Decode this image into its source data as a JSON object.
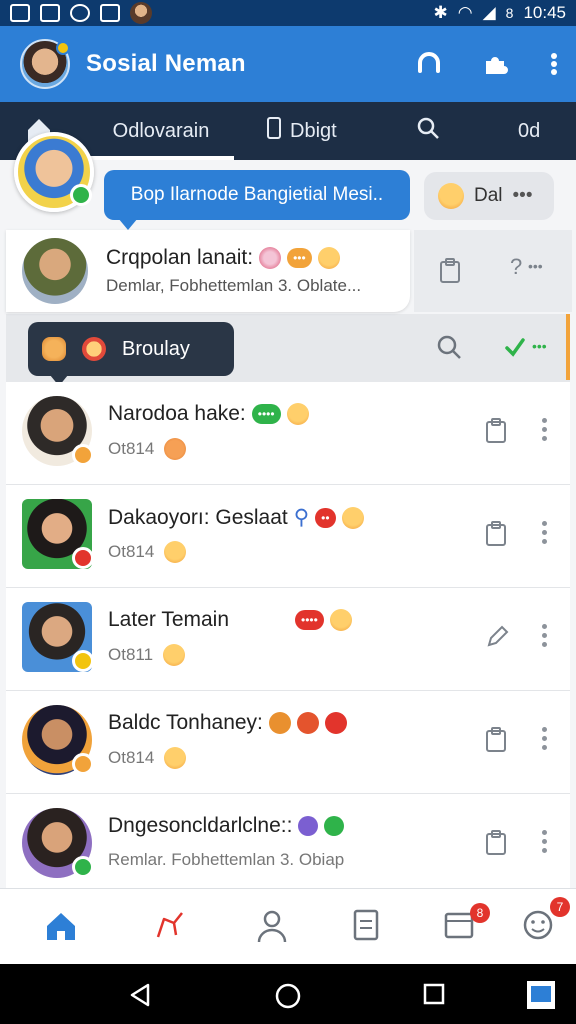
{
  "status_bar": {
    "time": "10:45",
    "battery_label": "8"
  },
  "app_bar": {
    "title": "Sosial Neman"
  },
  "tabs": [
    {
      "label": "Odlovarain"
    },
    {
      "label": "Dbigt"
    },
    {
      "label": "0d"
    }
  ],
  "highlight": {
    "text": "Bop Ilarnode Bangietial Mesi.."
  },
  "dal_chip": {
    "label": "Dal"
  },
  "featured": {
    "title": "Crqpolan lanait:",
    "subtitle": "Demlar, Fobhettemlan 3. Oblate..."
  },
  "sub_toolbar": {
    "label": "Broulay"
  },
  "chats": [
    {
      "name": "Narodoa hake:",
      "sub": "Ot814"
    },
    {
      "name": "Dakaoyorı: Geslaat",
      "sub": "Ot814"
    },
    {
      "name": "Later Temain",
      "sub": "Ot811"
    },
    {
      "name": "Baldc Tonhaney:",
      "sub": "Ot814"
    },
    {
      "name": "Dngesoncldarlclne::",
      "sub": "Remlar. Fobhettemlan 3. Obiap"
    }
  ],
  "bottom_nav": {
    "badge_news": "8",
    "badge_profile": "7"
  },
  "colors": {
    "primary": "#2d7fd6",
    "dark_tab": "#1d2e45",
    "accent_orange": "#f2a33a",
    "online_green": "#2fb34a",
    "alert_red": "#e2342c"
  },
  "icons": [
    "home-icon",
    "clipboard-icon",
    "search-icon",
    "more-vert-icon",
    "checkmark-icon",
    "pencil-icon",
    "share-icon",
    "user-icon",
    "document-icon",
    "calendar-icon",
    "smiley-icon",
    "back-icon",
    "home-circle-icon",
    "recents-icon"
  ]
}
